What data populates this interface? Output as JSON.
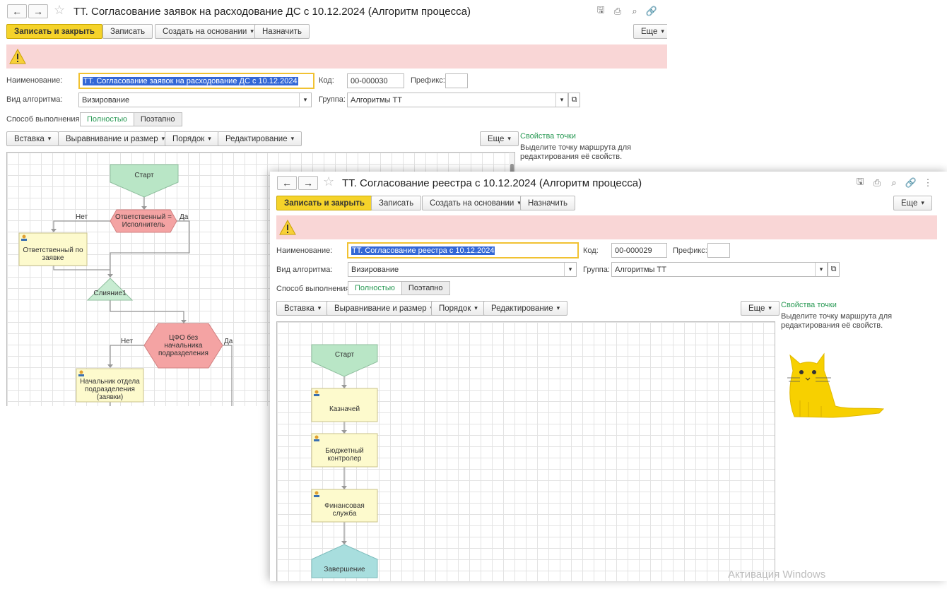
{
  "windows": [
    {
      "title": "ТТ. Согласование заявок на расходование ДС с 10.12.2024 (Алгоритм процесса)",
      "toolbar": {
        "save_close": "Записать и закрыть",
        "save": "Записать",
        "create_based": "Создать на основании",
        "assign": "Назначить",
        "more": "Еще"
      },
      "form": {
        "name_label": "Наименование:",
        "name_value": "ТТ. Согласование заявок на расходование ДС с 10.12.2024",
        "code_label": "Код:",
        "code_value": "00-000030",
        "prefix_label": "Префикс:",
        "prefix_value": "",
        "kind_label": "Вид алгоритма:",
        "kind_value": "Визирование",
        "group_label": "Группа:",
        "group_value": "Алгоритмы ТТ",
        "mode_label": "Способ выполнения:",
        "mode_full": "Полностью",
        "mode_step": "Поэтапно"
      },
      "editbar": {
        "insert": "Вставка",
        "align": "Выравнивание и размер",
        "order": "Порядок",
        "edit": "Редактирование",
        "more": "Еще"
      },
      "props": {
        "title": "Свойства точки",
        "text": "Выделите точку маршрута для редактирования её свойств."
      },
      "nodes": {
        "start": "Старт",
        "cond1": "Ответственный = Исполнитель",
        "resp": "Ответственный по заявке",
        "merge": "Слияние1",
        "cond2": "ЦФО без начальника подразделения",
        "head": "Начальник отдела подразделения (заявки)"
      },
      "edges": {
        "no": "Нет",
        "yes": "Да"
      }
    },
    {
      "title": "ТТ. Согласование реестра с 10.12.2024 (Алгоритм процесса)",
      "toolbar": {
        "save_close": "Записать и закрыть",
        "save": "Записать",
        "create_based": "Создать на основании",
        "assign": "Назначить",
        "more": "Еще"
      },
      "form": {
        "name_label": "Наименование:",
        "name_value": "ТТ. Согласование реестра с 10.12.2024",
        "code_label": "Код:",
        "code_value": "00-000029",
        "prefix_label": "Префикс:",
        "prefix_value": "",
        "kind_label": "Вид алгоритма:",
        "kind_value": "Визирование",
        "group_label": "Группа:",
        "group_value": "Алгоритмы ТТ",
        "mode_label": "Способ выполнения:",
        "mode_full": "Полностью",
        "mode_step": "Поэтапно"
      },
      "editbar": {
        "insert": "Вставка",
        "align": "Выравнивание и размер",
        "order": "Порядок",
        "edit": "Редактирование",
        "more": "Еще"
      },
      "props": {
        "title": "Свойства точки",
        "text": "Выделите точку маршрута для редактирования её свойств."
      },
      "nodes": {
        "start": "Старт",
        "treasurer": "Казначей",
        "budget": "Бюджетный контролер",
        "finance": "Финансовая служба",
        "end": "Завершение"
      }
    }
  ],
  "watermark": "Активация Windows",
  "colors": {
    "primary": "#f5d32a",
    "warning_band": "#f9d6d6",
    "start": "#b9e6c6",
    "condition": "#f4a3a3",
    "task": "#fdfacd",
    "end": "#a8dede",
    "accent_green": "#2a9a55"
  }
}
